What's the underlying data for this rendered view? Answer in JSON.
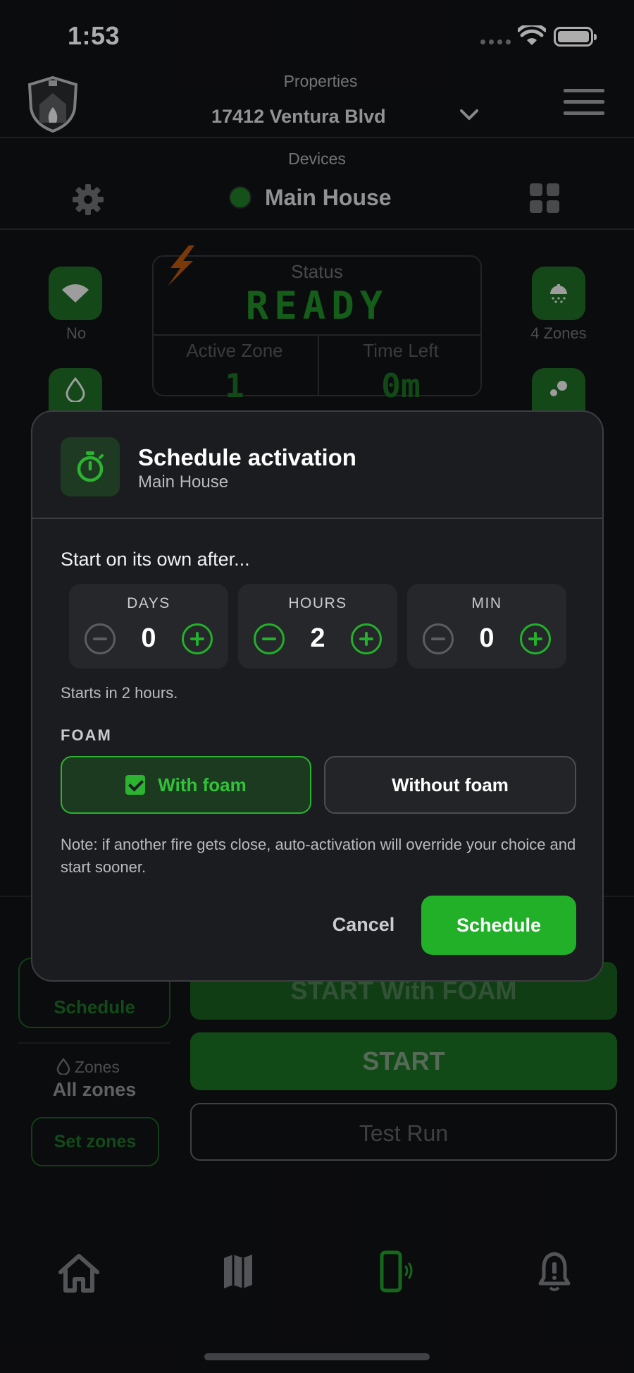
{
  "status_bar": {
    "time": "1:53"
  },
  "header": {
    "properties_label": "Properties",
    "property_value": "17412 Ventura Blvd"
  },
  "devices": {
    "label": "Devices",
    "device_name": "Main House"
  },
  "side": {
    "wifi_label": "No",
    "zones_label": "4 Zones"
  },
  "status": {
    "title": "Status",
    "value": "READY",
    "active_zone_label": "Active Zone",
    "active_zone_value": "1",
    "time_left_label": "Time Left",
    "time_left_value": "0m"
  },
  "lower": {
    "schedule_label": "Schedule",
    "zones_label": "Zones",
    "zones_value": "All zones",
    "set_zones_label": "Set zones",
    "start_foam_label": "START With FOAM",
    "start_label": "START",
    "test_run_label": "Test Run"
  },
  "modal": {
    "title": "Schedule activation",
    "subtitle": "Main House",
    "start_after": "Start on its own after...",
    "steppers": [
      {
        "label": "DAYS",
        "value": "0"
      },
      {
        "label": "HOURS",
        "value": "2"
      },
      {
        "label": "MIN",
        "value": "0"
      }
    ],
    "starts_in": "Starts in 2 hours.",
    "foam_label": "FOAM",
    "with_foam": "With foam",
    "without_foam": "Without foam",
    "note": "Note: if another fire gets close, auto-activation will override your choice and start sooner.",
    "cancel": "Cancel",
    "schedule": "Schedule"
  },
  "tabbar": {
    "active_tab": "device"
  },
  "colors": {
    "accent": "#22b029",
    "ready": "#1e8b27",
    "bolt": "#c25a10"
  }
}
